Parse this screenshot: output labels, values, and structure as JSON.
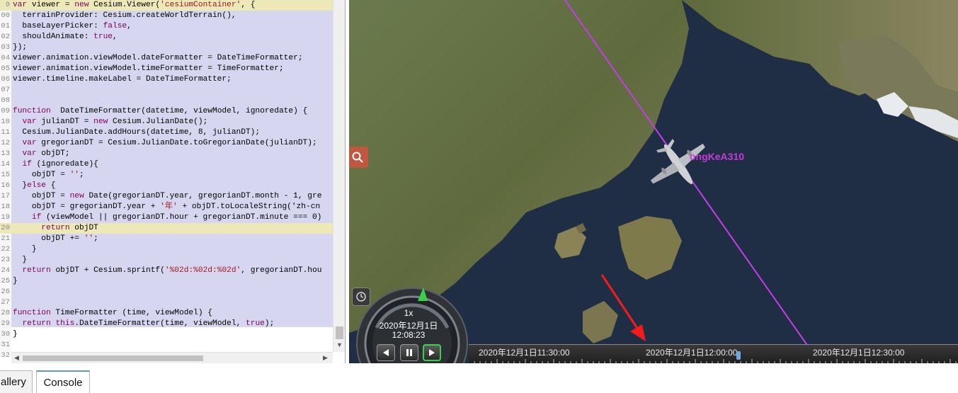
{
  "editor": {
    "lines": [
      {
        "n": "9",
        "t": "var viewer = new Cesium.Viewer('cesiumContainer', {",
        "hl": true
      },
      {
        "n": "00",
        "t": "  terrainProvider: Cesium.createWorldTerrain(),",
        "hl": false
      },
      {
        "n": "01",
        "t": "  baseLayerPicker: false,",
        "hl": false
      },
      {
        "n": "02",
        "t": "  shouldAnimate: true,",
        "hl": false
      },
      {
        "n": "03",
        "t": "});",
        "hl": false
      },
      {
        "n": "04",
        "t": "viewer.animation.viewModel.dateFormatter = DateTimeFormatter;",
        "hl": false
      },
      {
        "n": "05",
        "t": "viewer.animation.viewModel.timeFormatter = TimeFormatter;",
        "hl": false
      },
      {
        "n": "06",
        "t": "viewer.timeline.makeLabel = DateTimeFormatter;",
        "hl": false
      },
      {
        "n": "07",
        "t": "",
        "hl": false
      },
      {
        "n": "08",
        "t": "",
        "hl": false
      },
      {
        "n": "09",
        "t": "function  DateTimeFormatter(datetime, viewModel, ignoredate) {",
        "hl": false
      },
      {
        "n": "10",
        "t": "  var julianDT = new Cesium.JulianDate();",
        "hl": false
      },
      {
        "n": "11",
        "t": "  Cesium.JulianDate.addHours(datetime, 8, julianDT);",
        "hl": false
      },
      {
        "n": "12",
        "t": "  var gregorianDT = Cesium.JulianDate.toGregorianDate(julianDT);",
        "hl": false
      },
      {
        "n": "13",
        "t": "  var objDT;",
        "hl": false
      },
      {
        "n": "14",
        "t": "  if (ignoredate){",
        "hl": false
      },
      {
        "n": "15",
        "t": "    objDT = '';",
        "hl": false
      },
      {
        "n": "16",
        "t": "  }else {",
        "hl": false
      },
      {
        "n": "17",
        "t": "    objDT = new Date(gregorianDT.year, gregorianDT.month - 1, gre",
        "hl": false
      },
      {
        "n": "18",
        "t": "    objDT = gregorianDT.year + '年' + objDT.toLocaleString('zh-cn",
        "hl": false
      },
      {
        "n": "19",
        "t": "    if (viewModel || gregorianDT.hour + gregorianDT.minute === 0)",
        "hl": false
      },
      {
        "n": "20",
        "t": "      return objDT",
        "hl": true
      },
      {
        "n": "21",
        "t": "      objDT += '';",
        "hl": false
      },
      {
        "n": "22",
        "t": "    }",
        "hl": false
      },
      {
        "n": "23",
        "t": "  }",
        "hl": false
      },
      {
        "n": "24",
        "t": "  return objDT + Cesium.sprintf('%02d:%02d:%02d', gregorianDT.hou",
        "hl": false
      },
      {
        "n": "25",
        "t": "}",
        "hl": false
      },
      {
        "n": "26",
        "t": "",
        "hl": false
      },
      {
        "n": "27",
        "t": "",
        "hl": false
      },
      {
        "n": "28",
        "t": "function TimeFormatter (time, viewModel) {",
        "hl": false
      },
      {
        "n": "29",
        "t": "  return this.DateTimeFormatter(time, viewModel, true);",
        "hl": false
      },
      {
        "n": "30",
        "t": "}",
        "hl": false
      },
      {
        "n": "31",
        "t": "",
        "hl": false
      },
      {
        "n": "32",
        "t": "",
        "hl": false
      }
    ]
  },
  "viewer": {
    "entity_label": "ongKeA310",
    "animation": {
      "speed": "1x",
      "date": "2020年12月1日",
      "time": "12:08:23"
    },
    "timeline": {
      "labels": [
        "2020年12月1日11:30:00",
        "2020年12月1日12:00:00",
        "2020年12月1日12:30:00"
      ]
    },
    "colors": {
      "flight_path": "#c23ee8",
      "arrow": "#f21c1c",
      "ocean": "#1f2e44"
    }
  },
  "tabs": [
    {
      "label": "allery",
      "active": false
    },
    {
      "label": "Console",
      "active": true
    }
  ]
}
